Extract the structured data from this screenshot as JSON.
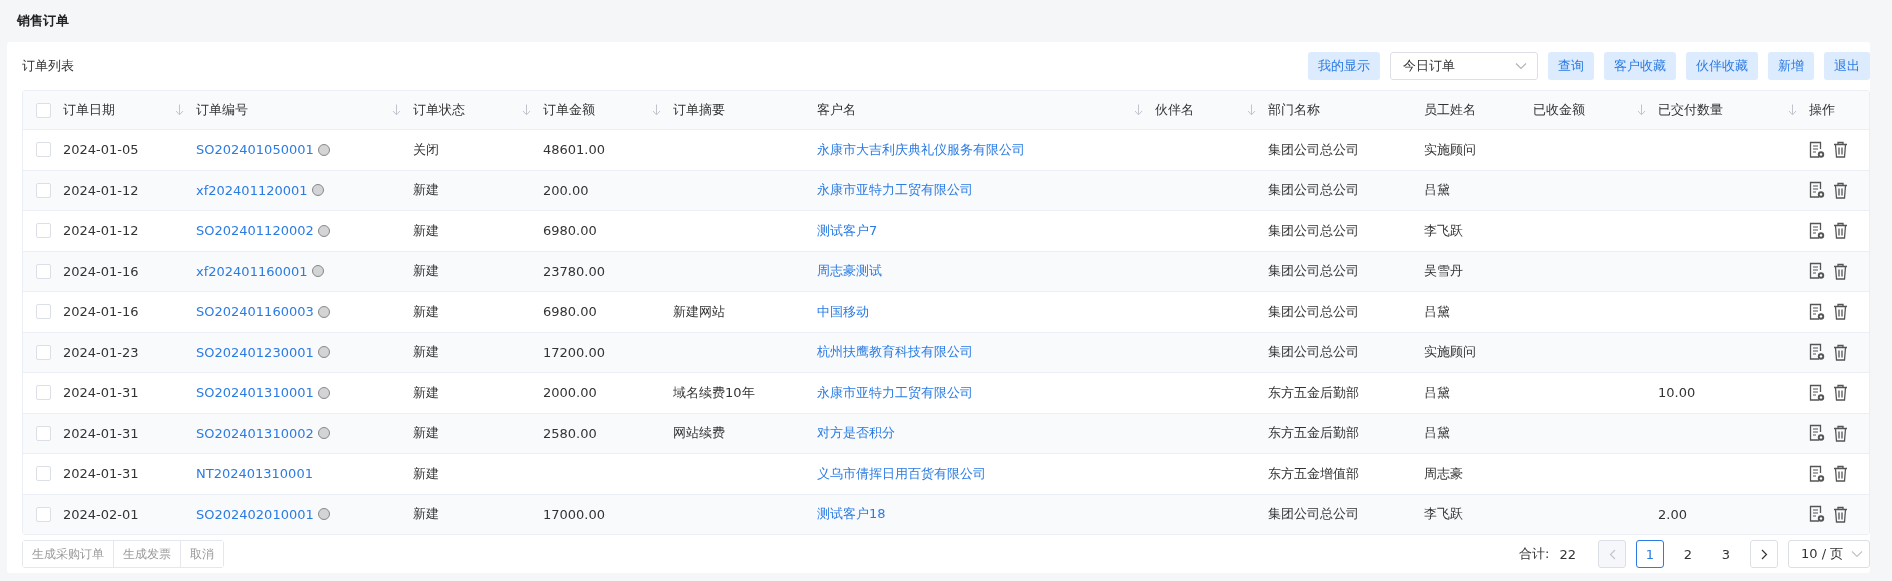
{
  "page_title": "销售订单",
  "list_title": "订单列表",
  "toolbar": {
    "my_view_button": "我的显示",
    "filter_select": "今日订单",
    "buttons": [
      "查询",
      "客户收藏",
      "伙伴收藏",
      "新增",
      "退出"
    ]
  },
  "table": {
    "all_checked": false,
    "columns": [
      {
        "label": "订单日期",
        "sortable": true
      },
      {
        "label": "订单编号",
        "sortable": true
      },
      {
        "label": "订单状态",
        "sortable": true
      },
      {
        "label": "订单金额",
        "sortable": true
      },
      {
        "label": "订单摘要",
        "sortable": false
      },
      {
        "label": "客户名",
        "sortable": true
      },
      {
        "label": "伙伴名",
        "sortable": true
      },
      {
        "label": "部门名称",
        "sortable": false
      },
      {
        "label": "员工姓名",
        "sortable": false
      },
      {
        "label": "已收金额",
        "sortable": true
      },
      {
        "label": "已交付数量",
        "sortable": true
      },
      {
        "label": "操作",
        "sortable": false
      }
    ],
    "rows": [
      {
        "checked": false,
        "date": "2024-01-05",
        "number": "SO202401050001",
        "status_dot": true,
        "status": "关闭",
        "amount": "48601.00",
        "summary": "",
        "customer": "永康市大吉利庆典礼仪服务有限公司",
        "partner": "",
        "department": "集团公司总公司",
        "employee": "实施顾问",
        "received": "",
        "delivered": ""
      },
      {
        "checked": false,
        "date": "2024-01-12",
        "number": "xf202401120001",
        "status_dot": true,
        "status": "新建",
        "amount": "200.00",
        "summary": "",
        "customer": "永康市亚特力工贸有限公司",
        "partner": "",
        "department": "集团公司总公司",
        "employee": "吕黛",
        "received": "",
        "delivered": ""
      },
      {
        "checked": false,
        "date": "2024-01-12",
        "number": "SO202401120002",
        "status_dot": true,
        "status": "新建",
        "amount": "6980.00",
        "summary": "",
        "customer": "测试客户7",
        "partner": "",
        "department": "集团公司总公司",
        "employee": "李飞跃",
        "received": "",
        "delivered": ""
      },
      {
        "checked": false,
        "date": "2024-01-16",
        "number": "xf202401160001",
        "status_dot": true,
        "status": "新建",
        "amount": "23780.00",
        "summary": "",
        "customer": "周志豪测试",
        "partner": "",
        "department": "集团公司总公司",
        "employee": "吴雪丹",
        "received": "",
        "delivered": ""
      },
      {
        "checked": false,
        "date": "2024-01-16",
        "number": "SO202401160003",
        "status_dot": true,
        "status": "新建",
        "amount": "6980.00",
        "summary": "新建网站",
        "customer": "中国移动",
        "partner": "",
        "department": "集团公司总公司",
        "employee": "吕黛",
        "received": "",
        "delivered": ""
      },
      {
        "checked": false,
        "date": "2024-01-23",
        "number": "SO202401230001",
        "status_dot": true,
        "status": "新建",
        "amount": "17200.00",
        "summary": "",
        "customer": "杭州扶鹰教育科技有限公司",
        "partner": "",
        "department": "集团公司总公司",
        "employee": "实施顾问",
        "received": "",
        "delivered": ""
      },
      {
        "checked": false,
        "date": "2024-01-31",
        "number": "SO202401310001",
        "status_dot": true,
        "status": "新建",
        "amount": "2000.00",
        "summary": "域名续费10年",
        "customer": "永康市亚特力工贸有限公司",
        "partner": "",
        "department": "东方五金后勤部",
        "employee": "吕黛",
        "received": "",
        "delivered": "10.00"
      },
      {
        "checked": false,
        "date": "2024-01-31",
        "number": "SO202401310002",
        "status_dot": true,
        "status": "新建",
        "amount": "2580.00",
        "summary": "网站续费",
        "customer": "对方是否积分",
        "partner": "",
        "department": "东方五金后勤部",
        "employee": "吕黛",
        "received": "",
        "delivered": ""
      },
      {
        "checked": false,
        "date": "2024-01-31",
        "number": "NT202401310001",
        "status_dot": false,
        "status": "新建",
        "amount": "",
        "summary": "",
        "customer": "义乌市倩挥日用百货有限公司",
        "partner": "",
        "department": "东方五金增值部",
        "employee": "周志豪",
        "received": "",
        "delivered": ""
      },
      {
        "checked": false,
        "date": "2024-02-01",
        "number": "SO202402010001",
        "status_dot": true,
        "status": "新建",
        "amount": "17000.00",
        "summary": "",
        "customer": "测试客户18",
        "partner": "",
        "department": "集团公司总公司",
        "employee": "李飞跃",
        "received": "",
        "delivered": "2.00"
      }
    ]
  },
  "bulk_actions": [
    "生成采购订单",
    "生成发票",
    "取消"
  ],
  "pagination": {
    "total_label": "合计:",
    "total": "22",
    "pages": [
      {
        "label": "1",
        "selected": true
      },
      {
        "label": "2",
        "selected": false
      },
      {
        "label": "3",
        "selected": false
      }
    ],
    "prev_disabled": true,
    "next_disabled": false,
    "page_size": "10 / 页"
  }
}
